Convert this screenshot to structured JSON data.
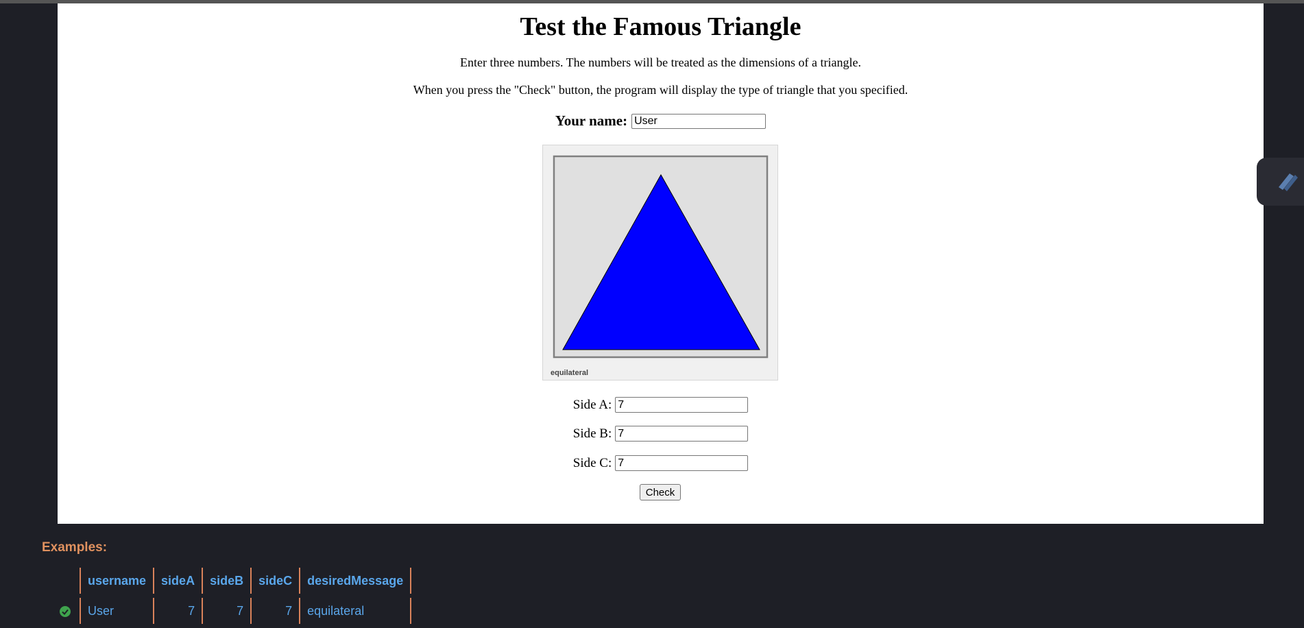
{
  "page": {
    "title": "Test the Famous Triangle",
    "intro_1": "Enter three numbers. The numbers will be treated as the dimensions of a triangle.",
    "intro_2": "When you press the \"Check\" button, the program will display the type of triangle that you specified."
  },
  "form": {
    "name_label": "Your name:",
    "name_value": "User",
    "side_a_label": "Side A:",
    "side_a_value": "7",
    "side_b_label": "Side B:",
    "side_b_value": "7",
    "side_c_label": "Side C:",
    "side_c_value": "7",
    "check_label": "Check"
  },
  "canvas": {
    "triangle_type": "equilateral",
    "triangle_fill": "#0000ff",
    "panel_bg": "#e0e0e0"
  },
  "examples": {
    "heading": "Examples:",
    "columns": [
      "username",
      "sideA",
      "sideB",
      "sideC",
      "desiredMessage"
    ],
    "rows": [
      {
        "status": "check-circle-icon",
        "status_color": "#3fa34d",
        "username": "User",
        "sideA": "7",
        "sideB": "7",
        "sideC": "7",
        "desiredMessage": "equilateral"
      }
    ]
  },
  "floating_tab": {
    "icon": "pencil-icon"
  }
}
